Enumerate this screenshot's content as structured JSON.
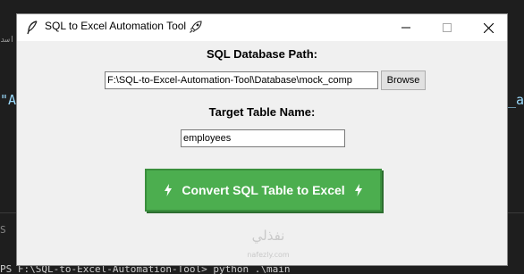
{
  "background": {
    "left_top_text": "اسد",
    "left_mid_text": "\"A",
    "right_mid_text": "_a",
    "left_s_text": "S",
    "bottom_text": "PS F:\\SQL-to-Excel-Automation-Tool> python .\\main"
  },
  "window": {
    "title": "SQL to Excel Automation Tool",
    "title_icon": "feather-icon",
    "title_emoji_icon": "rocket-icon",
    "controls": [
      "minimize",
      "maximize",
      "close"
    ]
  },
  "form": {
    "db_path_label": "SQL Database Path:",
    "db_path_value": "F:\\SQL-to-Excel-Automation-Tool\\Database\\mock_comp",
    "browse_label": "Browse",
    "table_label": "Target Table Name:",
    "table_value": "employees",
    "convert_label": "Convert SQL Table to Excel",
    "convert_icon": "lightning-icon"
  },
  "watermark": {
    "text": "نفذلي",
    "sub": "nafezly.com"
  },
  "colors": {
    "convert_bg": "#4cae4f",
    "window_bg": "#f0f0f0",
    "desktop_bg": "#1e1e1e"
  }
}
